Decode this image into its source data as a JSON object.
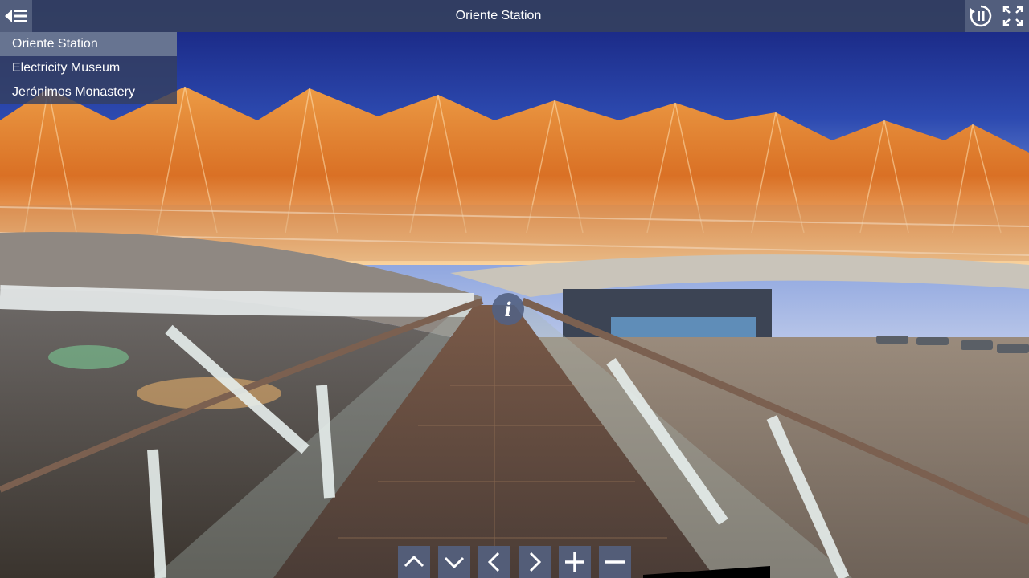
{
  "window": {
    "title": "Oriente Station"
  },
  "topbar": {
    "menu_toggle_icon": "sidebar-collapse-icon",
    "autorotate_icon": "pause-autorotate-icon",
    "fullscreen_icon": "fullscreen-icon"
  },
  "scenes": [
    {
      "label": "Oriente Station",
      "active": true
    },
    {
      "label": "Electricity Museum",
      "active": false
    },
    {
      "label": "Jerónimos Monastery",
      "active": false
    }
  ],
  "hotspot": {
    "glyph": "i",
    "icon": "info-icon"
  },
  "view_controls": [
    {
      "icon": "chevron-up-icon",
      "action": "look up"
    },
    {
      "icon": "chevron-down-icon",
      "action": "look down"
    },
    {
      "icon": "chevron-left-icon",
      "action": "look left"
    },
    {
      "icon": "chevron-right-icon",
      "action": "look right"
    },
    {
      "icon": "plus-icon",
      "action": "zoom in"
    },
    {
      "icon": "minus-icon",
      "action": "zoom out"
    }
  ],
  "colors": {
    "bar": "#344060",
    "button": "#54607e",
    "active_item": "#6e7a96",
    "sky_top": "#1c2a8c",
    "canopy": "#f08a30"
  }
}
